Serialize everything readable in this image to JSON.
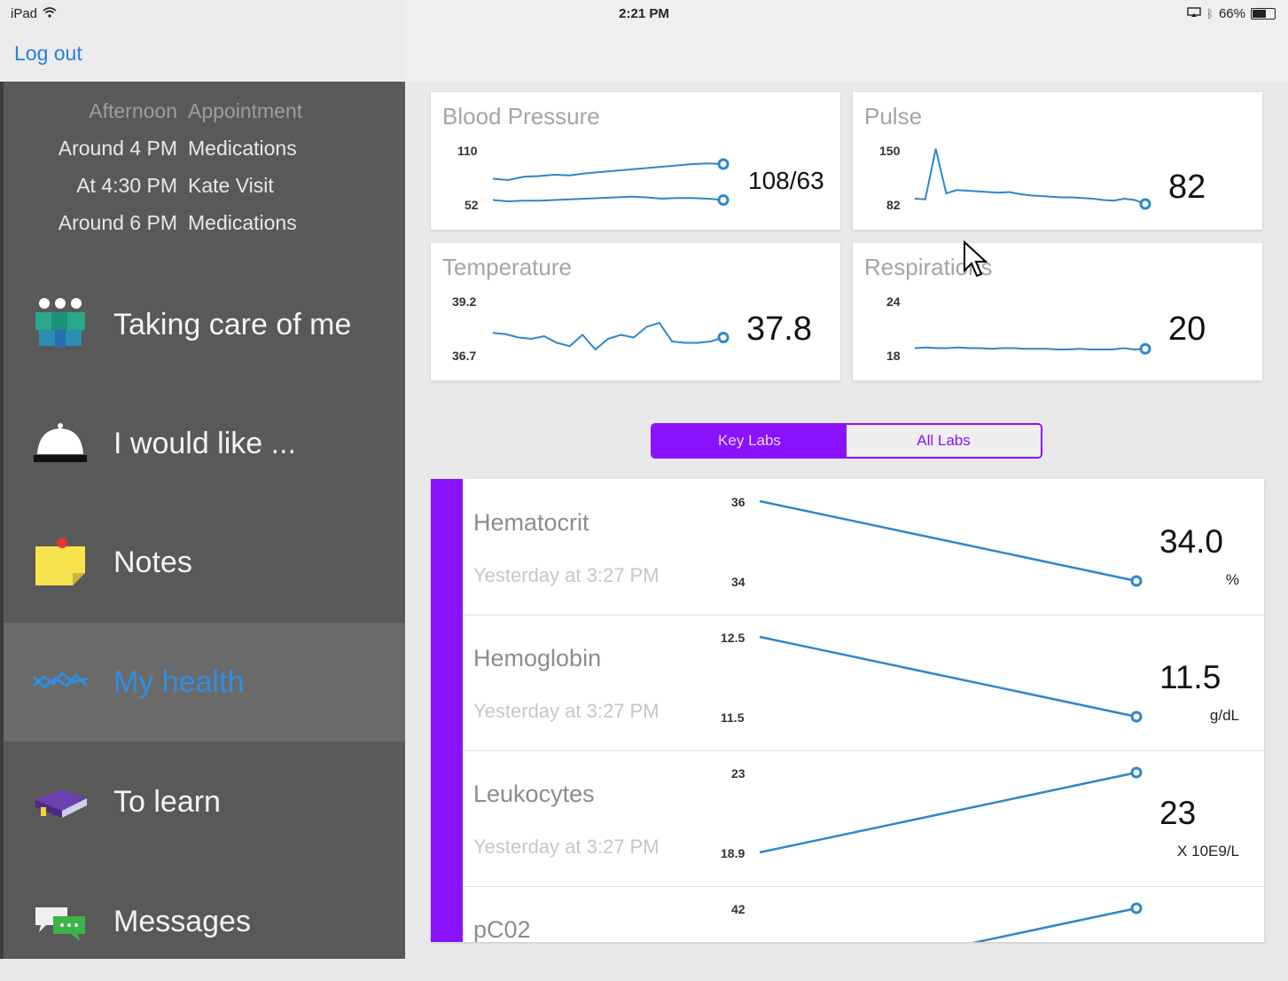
{
  "status_bar": {
    "device": "iPad",
    "time": "2:21 PM",
    "battery": "66%",
    "battery_level": 0.66
  },
  "header": {
    "logout_label": "Log out"
  },
  "schedule": {
    "header": {
      "time": "Afternoon",
      "what": "Appointment"
    },
    "items": [
      {
        "time": "Around 4 PM",
        "what": "Medications"
      },
      {
        "time": "At 4:30 PM",
        "what": "Kate Visit"
      },
      {
        "time": "Around 6 PM",
        "what": "Medications"
      }
    ]
  },
  "nav": {
    "items": [
      {
        "label": "Taking care of me",
        "icon": "care-team-icon"
      },
      {
        "label": "I would like ...",
        "icon": "service-bell-icon"
      },
      {
        "label": "Notes",
        "icon": "sticky-note-icon"
      },
      {
        "label": "My health",
        "icon": "health-chart-icon",
        "active": true
      },
      {
        "label": "To learn",
        "icon": "book-icon"
      },
      {
        "label": "Messages",
        "icon": "chat-bubbles-icon"
      }
    ]
  },
  "colors": {
    "accent": "#8a12ff",
    "line": "#2f86c9",
    "nav_active": "#2f8ee3"
  },
  "vitals": [
    {
      "title": "Blood Pressure",
      "value": "108/63",
      "y_max": "110",
      "y_min": "52",
      "series": [
        [
          50,
          48,
          53,
          54,
          56,
          55,
          58,
          60,
          62,
          64,
          66,
          68,
          70,
          72,
          73,
          72
        ],
        [
          18,
          16,
          17,
          17,
          18,
          19,
          20,
          21,
          22,
          23,
          22,
          20,
          21,
          21,
          20,
          18
        ]
      ]
    },
    {
      "title": "Pulse",
      "value": "82",
      "y_max": "150",
      "y_min": "82",
      "series": [
        [
          20,
          19,
          95,
          28,
          33,
          32,
          31,
          30,
          29,
          30,
          27,
          25,
          24,
          23,
          22,
          22,
          21,
          20,
          18,
          17,
          20,
          18,
          12
        ]
      ]
    },
    {
      "title": "Temperature",
      "value": "37.8",
      "y_max": "39.2",
      "y_min": "36.7",
      "series": [
        [
          45,
          43,
          38,
          36,
          40,
          30,
          25,
          42,
          20,
          36,
          42,
          38,
          54,
          60,
          32,
          30,
          30,
          32,
          38
        ]
      ]
    },
    {
      "title": "Respirations",
      "value": "20",
      "y_max": "24",
      "y_min": "18",
      "series": [
        [
          22,
          23,
          22,
          22,
          23,
          22,
          22,
          21,
          22,
          22,
          21,
          21,
          21,
          20,
          20,
          21,
          20,
          20,
          20,
          22,
          20,
          21
        ]
      ]
    }
  ],
  "labs_toggle": {
    "key_labs": "Key Labs",
    "all_labs": "All Labs",
    "selected": "key_labs"
  },
  "labs": [
    {
      "name": "Hematocrit",
      "time": "Yesterday at 3:27 PM",
      "value": "34.0",
      "unit": "%",
      "tick_top": "36",
      "tick_bottom": "34",
      "start": 36,
      "end": 34
    },
    {
      "name": "Hemoglobin",
      "time": "Yesterday at 3:27 PM",
      "value": "11.5",
      "unit": "g/dL",
      "tick_top": "12.5",
      "tick_bottom": "11.5",
      "start": 12.5,
      "end": 11.5
    },
    {
      "name": "Leukocytes",
      "time": "Yesterday at 3:27 PM",
      "value": "23",
      "unit": "X 10E9/L",
      "tick_top": "23",
      "tick_bottom": "18.9",
      "start": 18.9,
      "end": 23
    },
    {
      "name": "pC02",
      "time": "",
      "value": "",
      "unit": "",
      "tick_top": "42",
      "tick_bottom": "",
      "start": 40,
      "end": 42
    }
  ]
}
